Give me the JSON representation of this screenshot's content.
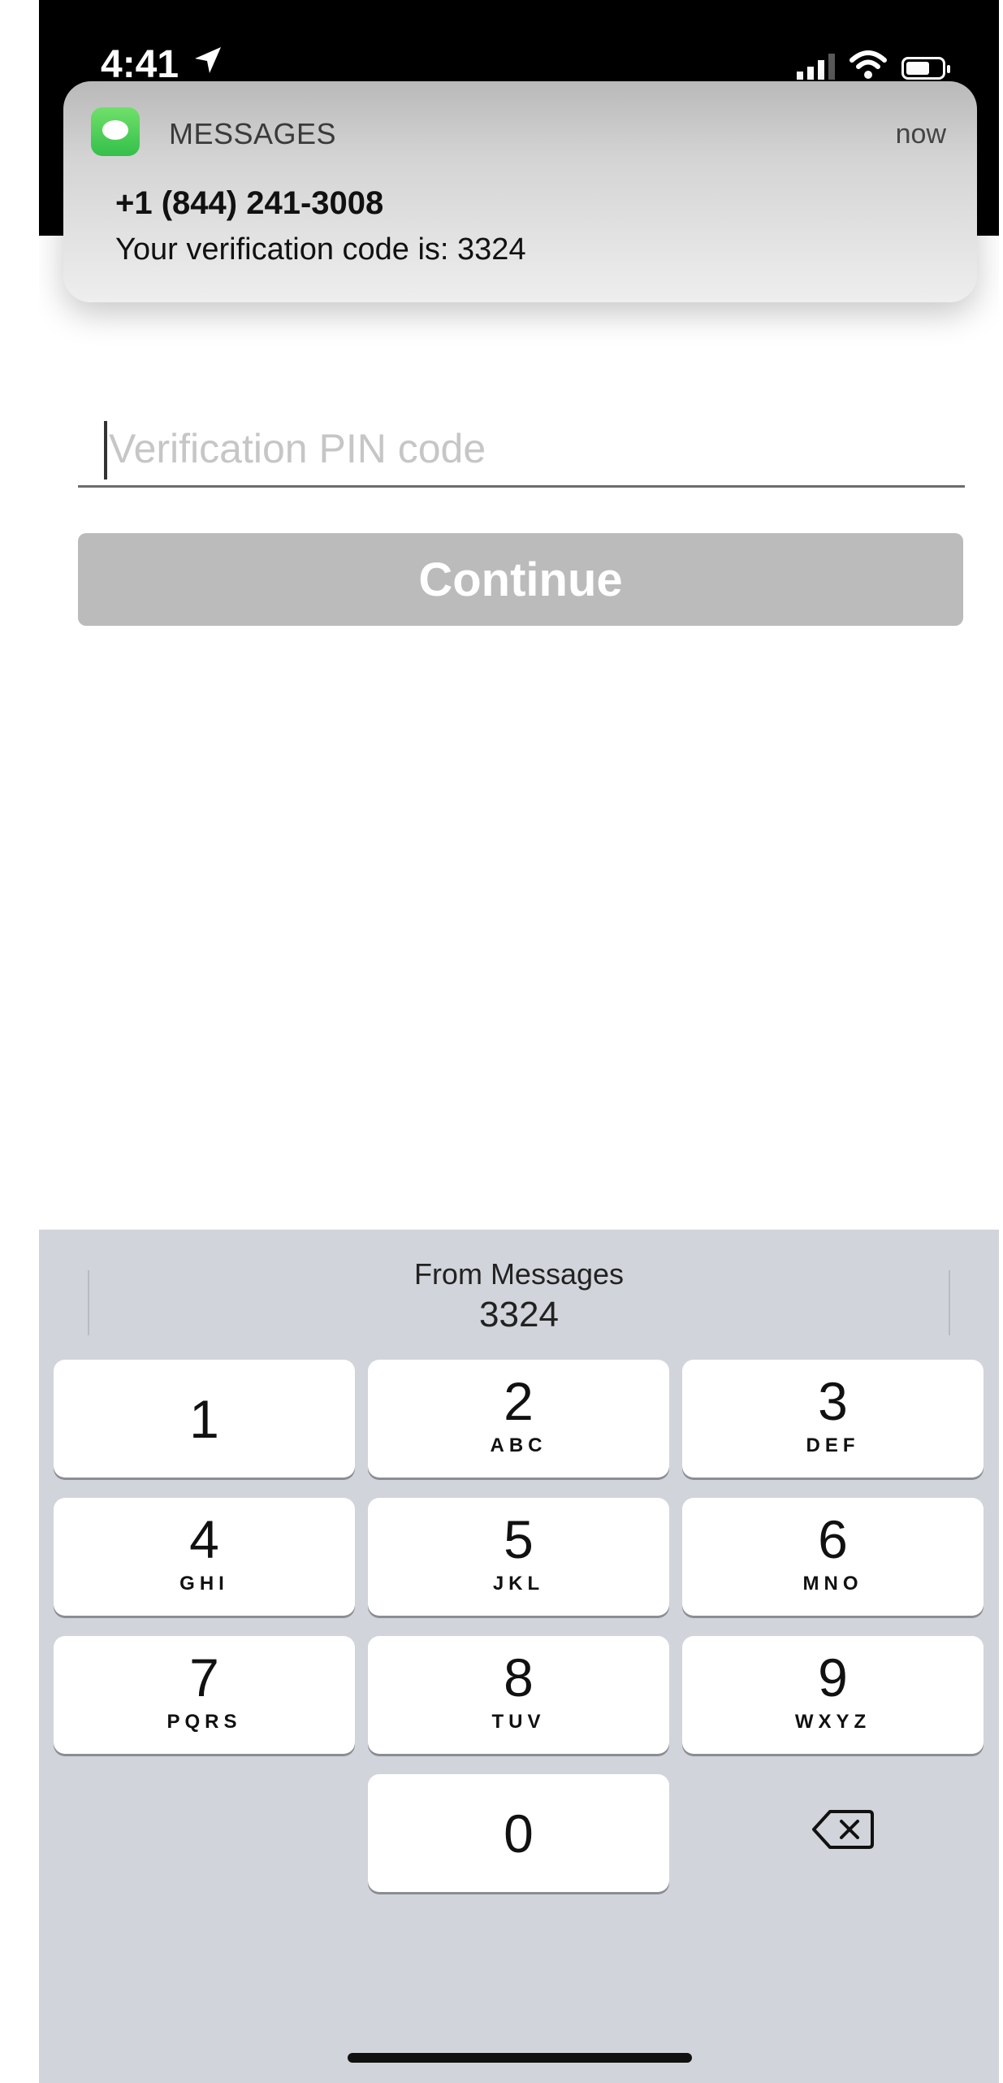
{
  "status_bar": {
    "time": "4:41",
    "icons": [
      "location-arrow-icon",
      "signal-icon",
      "wifi-icon",
      "battery-icon"
    ],
    "background": "#000000"
  },
  "notification": {
    "app_name": "MESSAGES",
    "app_icon": "messages-app-icon",
    "time": "now",
    "sender": "+1 (844) 241-3008",
    "body": "Your verification code is: 3324"
  },
  "form": {
    "pin_placeholder": "Verification PIN code",
    "pin_value": "",
    "continue_label": "Continue",
    "continue_color": "#bbbbbb"
  },
  "keyboard": {
    "suggestion": {
      "source": "From Messages",
      "code": "3324"
    },
    "keys": [
      {
        "num": "1",
        "letters": ""
      },
      {
        "num": "2",
        "letters": "ABC"
      },
      {
        "num": "3",
        "letters": "DEF"
      },
      {
        "num": "4",
        "letters": "GHI"
      },
      {
        "num": "5",
        "letters": "JKL"
      },
      {
        "num": "6",
        "letters": "MNO"
      },
      {
        "num": "7",
        "letters": "PQRS"
      },
      {
        "num": "8",
        "letters": "TUV"
      },
      {
        "num": "9",
        "letters": "WXYZ"
      },
      {
        "num": "0",
        "letters": ""
      }
    ],
    "delete_icon": "backspace-icon",
    "background": "#d1d4da"
  }
}
